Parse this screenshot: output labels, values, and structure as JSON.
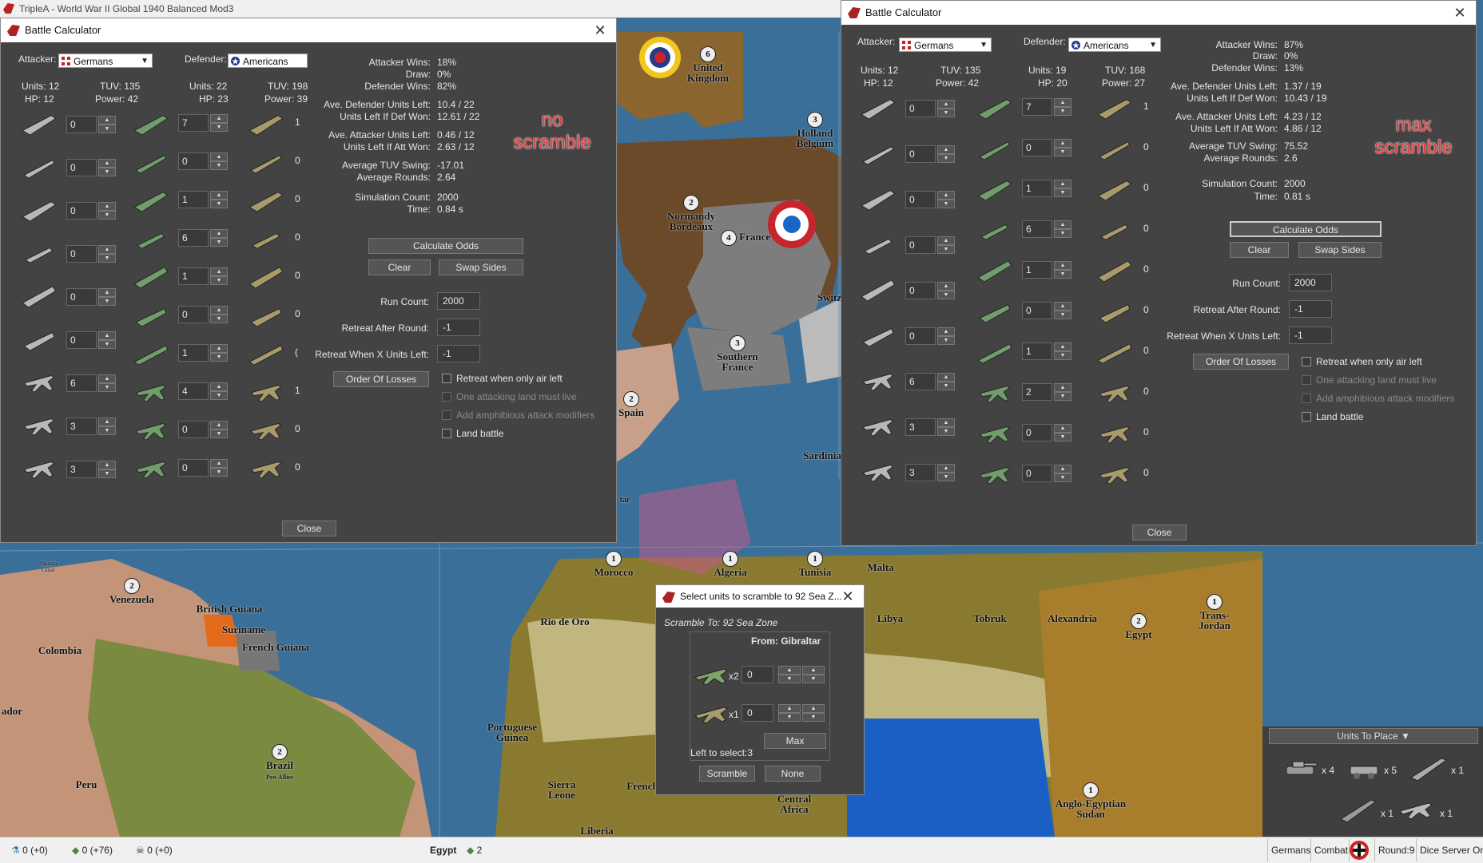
{
  "app": {
    "title": "TripleA - World War II Global 1940 Balanced Mod3"
  },
  "map_labels": {
    "united_kingdom": "United Kingdom",
    "holland_belgium": "Holland Belgium",
    "normandy_bordeaux": "Normandy Bordeaux",
    "france": "France",
    "southern_france": "Southern France",
    "switz": "Switz",
    "spain": "Spain",
    "sardinia": "Sardinia",
    "morocco": "Morocco",
    "algeria": "Algeria",
    "tunisia": "Tunisia",
    "malta": "Malta",
    "libya": "Libya",
    "tobruk": "Tobruk",
    "alexandria": "Alexandria",
    "egypt": "Egypt",
    "trans_jordan": "Trans-Jordan",
    "anglo_egyptian_sudan": "Anglo-Egyptian Sudan",
    "venezuela": "Venezuela",
    "colombia": "Colombia",
    "british_guiana": "British Guiana",
    "suriname": "Suriname",
    "french_guiana": "French Guiana",
    "brazil": "Brazil",
    "pro_allies": "Pro-Allies",
    "peru": "Peru",
    "rio_de_oro": "Rio de Oro",
    "portuguese_guinea": "Portuguese Guinea",
    "sierra_leone": "Sierra Leone",
    "liberia": "Liberia",
    "french": "French",
    "central_africa": "Central Africa",
    "ador": "ador",
    "tar": "tar",
    "panama_canal": "Panama Canal"
  },
  "calc_left": {
    "title": "Battle Calculator",
    "attacker_label": "Attacker:",
    "attacker": "Germans",
    "defender_label": "Defender:",
    "defender": "Americans",
    "att_units": "Units: 12",
    "att_tuv": "TUV: 135",
    "att_hp": "HP: 12",
    "att_power": "Power: 42",
    "def_units": "Units: 22",
    "def_tuv": "TUV: 198",
    "def_hp": "HP: 23",
    "def_power": "Power: 39",
    "attacker_counts": [
      "0",
      "0",
      "0",
      "0",
      "0",
      "0",
      "6",
      "3",
      "3"
    ],
    "defender_counts": [
      "7",
      "0",
      "1",
      "6",
      "1",
      "0",
      "1",
      "4",
      "0",
      "0"
    ],
    "third_col": [
      "1",
      "0",
      "0",
      "0",
      "0",
      "0",
      "(",
      "1",
      "0",
      "0"
    ],
    "results": [
      {
        "k": "Attacker Wins:",
        "v": "18%"
      },
      {
        "k": "Draw:",
        "v": "0%"
      },
      {
        "k": "Defender Wins:",
        "v": "82%"
      },
      {
        "k": "Ave. Defender Units Left:",
        "v": "10.4 / 22"
      },
      {
        "k": "Units Left If Def Won:",
        "v": "12.61 / 22"
      },
      {
        "k": "Ave. Attacker Units Left:",
        "v": "0.46 / 12"
      },
      {
        "k": "Units Left If Att Won:",
        "v": "2.63 / 12"
      },
      {
        "k": "Average TUV Swing:",
        "v": "-17.01"
      },
      {
        "k": "Average Rounds:",
        "v": "2.64"
      },
      {
        "k": "Simulation Count:",
        "v": "2000"
      },
      {
        "k": "Time:",
        "v": "0.84 s"
      }
    ],
    "calculate": "Calculate Odds",
    "clear": "Clear",
    "swap": "Swap Sides",
    "run_count_label": "Run Count:",
    "run_count": "2000",
    "retreat_round_label": "Retreat After Round:",
    "retreat_round": "-1",
    "retreat_units_label": "Retreat When X Units Left:",
    "retreat_units": "-1",
    "order_losses": "Order Of Losses",
    "cb_air": "Retreat when only air left",
    "cb_land": "One attacking land must live",
    "cb_amph": "Add amphibious attack modifiers",
    "cb_landbattle": "Land battle",
    "close": "Close",
    "annotation_line1": "no",
    "annotation_line2": "scramble"
  },
  "calc_right": {
    "title": "Battle Calculator",
    "attacker_label": "Attacker:",
    "attacker": "Germans",
    "defender_label": "Defender:",
    "defender": "Americans",
    "att_units": "Units: 12",
    "att_tuv": "TUV: 135",
    "att_hp": "HP: 12",
    "att_power": "Power: 42",
    "def_units": "Units: 19",
    "def_tuv": "TUV: 168",
    "def_hp": "HP: 20",
    "def_power": "Power: 27",
    "attacker_counts": [
      "0",
      "0",
      "0",
      "0",
      "0",
      "0",
      "6",
      "3",
      "3"
    ],
    "defender_counts": [
      "7",
      "0",
      "1",
      "6",
      "1",
      "0",
      "1",
      "2",
      "0",
      "0"
    ],
    "third_col": [
      "1",
      "0",
      "0",
      "0",
      "0",
      "0",
      "0",
      "0",
      "0",
      "0"
    ],
    "results": [
      {
        "k": "Attacker Wins:",
        "v": "87%"
      },
      {
        "k": "Draw:",
        "v": "0%"
      },
      {
        "k": "Defender Wins:",
        "v": "13%"
      },
      {
        "k": "Ave. Defender Units Left:",
        "v": "1.37 / 19"
      },
      {
        "k": "Units Left If Def Won:",
        "v": "10.43 / 19"
      },
      {
        "k": "Ave. Attacker Units Left:",
        "v": "4.23 / 12"
      },
      {
        "k": "Units Left If Att Won:",
        "v": "4.86 / 12"
      },
      {
        "k": "Average TUV Swing:",
        "v": "75.52"
      },
      {
        "k": "Average Rounds:",
        "v": "2.6"
      },
      {
        "k": "Simulation Count:",
        "v": "2000"
      },
      {
        "k": "Time:",
        "v": "0.81 s"
      }
    ],
    "calculate": "Calculate Odds",
    "clear": "Clear",
    "swap": "Swap Sides",
    "run_count_label": "Run Count:",
    "run_count": "2000",
    "retreat_round_label": "Retreat After Round:",
    "retreat_round": "-1",
    "retreat_units_label": "Retreat When X Units Left:",
    "retreat_units": "-1",
    "order_losses": "Order Of Losses",
    "cb_air": "Retreat when only air left",
    "cb_land": "One attacking land must live",
    "cb_amph": "Add amphibious attack modifiers",
    "cb_landbattle": "Land battle",
    "close": "Close",
    "annotation_line1": "max",
    "annotation_line2": "scramble"
  },
  "scramble": {
    "title": "Select units to scramble to 92 Sea Z...",
    "heading": "Scramble To: 92 Sea Zone",
    "from": "From: Gibraltar",
    "row1_mult": "x2",
    "row1_value": "0",
    "row2_mult": "x1",
    "row2_value": "0",
    "max": "Max",
    "left": "Left to select:3",
    "scramble_btn": "Scramble",
    "none_btn": "None"
  },
  "units_to_place": {
    "header": "Units To Place ▼",
    "counts": [
      "x 4",
      "x 5",
      "x 1",
      "x 1",
      "x 1"
    ]
  },
  "status": {
    "tech": "0 (+0)",
    "pus": "0 (+76)",
    "resource": "0 (+0)",
    "territory": "Egypt",
    "territory_value": "2",
    "nation": "Germans",
    "phase": "Combat",
    "round": "Round:9",
    "dice": "Dice Server On"
  },
  "colors": {
    "window_bg": "#434343",
    "annotation": "#e53a3a",
    "sea": "#3a6f99",
    "germany": "#7a5a36",
    "france": "#888888",
    "uk": "#a47a3a"
  }
}
